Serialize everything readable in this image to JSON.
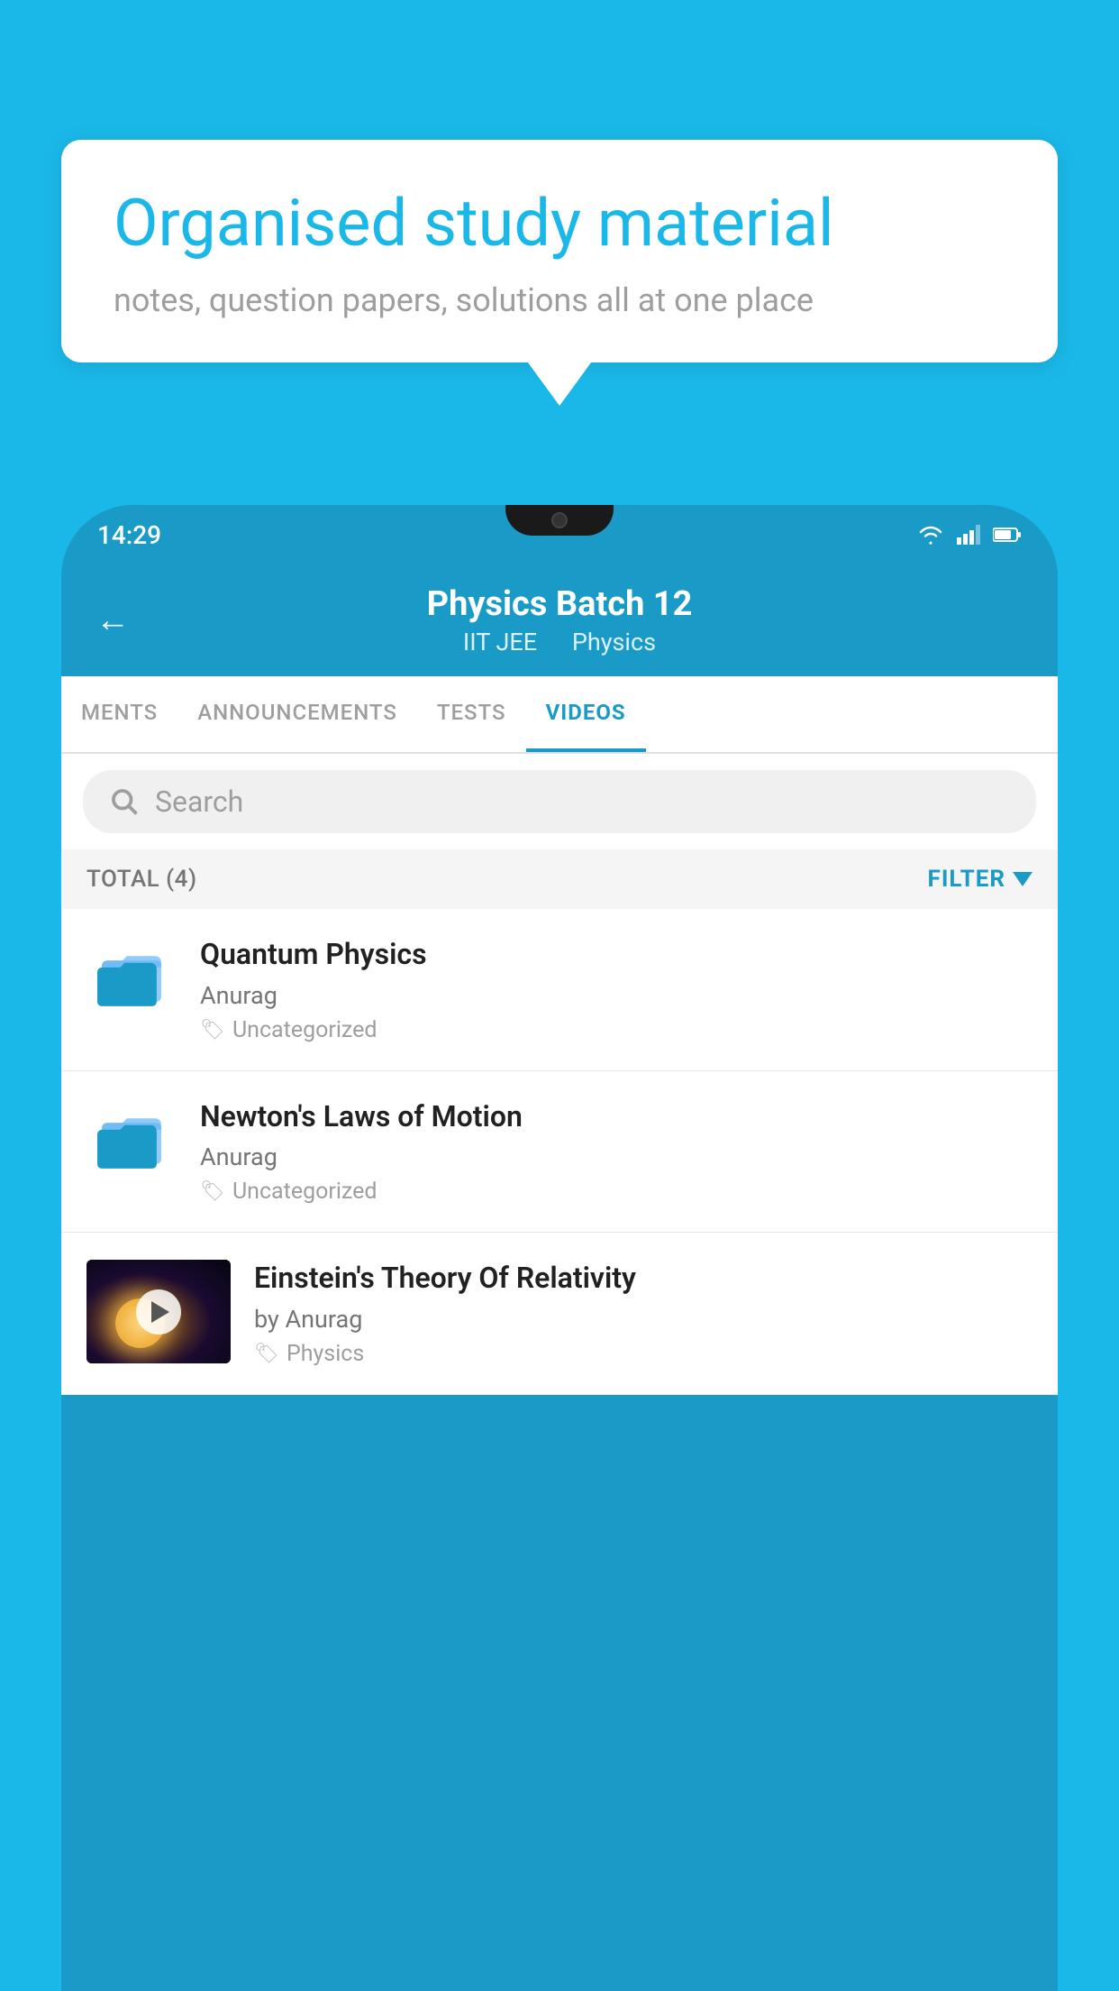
{
  "background_color": "#1ab8e8",
  "speech_bubble": {
    "title": "Organised study material",
    "subtitle": "notes, question papers, solutions all at one place"
  },
  "phone": {
    "status_bar": {
      "time": "14:29",
      "icons": [
        "wifi",
        "signal",
        "battery"
      ]
    },
    "header": {
      "back_label": "←",
      "title": "Physics Batch 12",
      "tag1": "IIT JEE",
      "tag2": "Physics"
    },
    "tabs": [
      {
        "label": "MENTS",
        "active": false
      },
      {
        "label": "ANNOUNCEMENTS",
        "active": false
      },
      {
        "label": "TESTS",
        "active": false
      },
      {
        "label": "VIDEOS",
        "active": true
      }
    ],
    "search": {
      "placeholder": "Search"
    },
    "filter_bar": {
      "total_label": "TOTAL (4)",
      "filter_label": "FILTER"
    },
    "videos": [
      {
        "id": 1,
        "title": "Quantum Physics",
        "author": "Anurag",
        "tag": "Uncategorized",
        "type": "folder"
      },
      {
        "id": 2,
        "title": "Newton's Laws of Motion",
        "author": "Anurag",
        "tag": "Uncategorized",
        "type": "folder"
      },
      {
        "id": 3,
        "title": "Einstein's Theory Of Relativity",
        "author": "by Anurag",
        "tag": "Physics",
        "type": "video"
      }
    ]
  }
}
